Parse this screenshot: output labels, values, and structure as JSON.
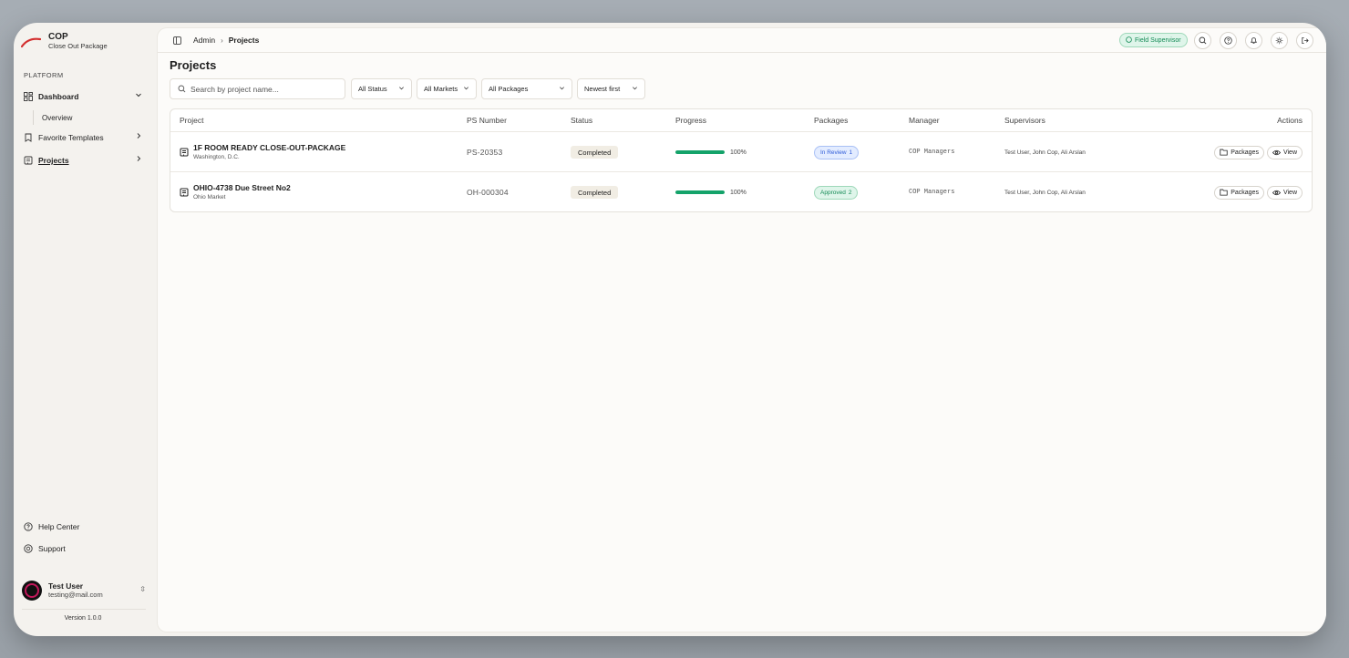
{
  "brand": {
    "title": "COP",
    "subtitle": "Close Out Package"
  },
  "sidebar": {
    "section_label": "PLATFORM",
    "items": [
      {
        "label": "Dashboard",
        "icon": "dashboard-icon",
        "expanded": true
      },
      {
        "label": "Overview"
      },
      {
        "label": "Favorite Templates",
        "icon": "bookmark-icon"
      },
      {
        "label": "Projects",
        "icon": "building-icon",
        "active": true
      }
    ],
    "footer_links": [
      {
        "label": "Help Center",
        "icon": "help-circle-icon"
      },
      {
        "label": "Support",
        "icon": "lifebuoy-icon"
      }
    ],
    "user": {
      "name": "Test User",
      "email": "testing@mail.com"
    },
    "version": "Version 1.0.0"
  },
  "topbar": {
    "breadcrumb": [
      "Admin",
      "Projects"
    ],
    "role_badge": "Field Supervisor",
    "icons": [
      "search-icon",
      "help-icon",
      "bell-icon",
      "sun-icon",
      "logout-icon"
    ]
  },
  "page": {
    "title": "Projects"
  },
  "filters": {
    "search_placeholder": "Search by project name...",
    "status": "All Status",
    "markets": "All Markets",
    "packages": "All Packages",
    "sort": "Newest first"
  },
  "table": {
    "headers": [
      "Project",
      "PS Number",
      "Status",
      "Progress",
      "Packages",
      "Manager",
      "Supervisors",
      "Actions"
    ],
    "rows": [
      {
        "name": "1F ROOM READY CLOSE-OUT-PACKAGE",
        "location": "Washington, D.C.",
        "ps_number": "PS-20353",
        "status": "Completed",
        "progress": 100,
        "progress_label": "100%",
        "package_status": "In Review",
        "package_count": "1",
        "manager": "COP Managers",
        "supervisors": "Test User, John Cop, Ali Arslan",
        "actions": [
          "Packages",
          "View"
        ]
      },
      {
        "name": "OHIO-4738 Due Street No2",
        "location": "Ohio Market",
        "ps_number": "OH-000304",
        "status": "Completed",
        "progress": 100,
        "progress_label": "100%",
        "package_status": "Approved",
        "package_count": "2",
        "manager": "COP Managers",
        "supervisors": "Test User, John Cop, Ali Arslan",
        "actions": [
          "Packages",
          "View"
        ]
      }
    ]
  },
  "colors": {
    "accent_green": "#14a36a",
    "review_blue": "#2e5bd8",
    "brand_red": "#d32f2f"
  }
}
